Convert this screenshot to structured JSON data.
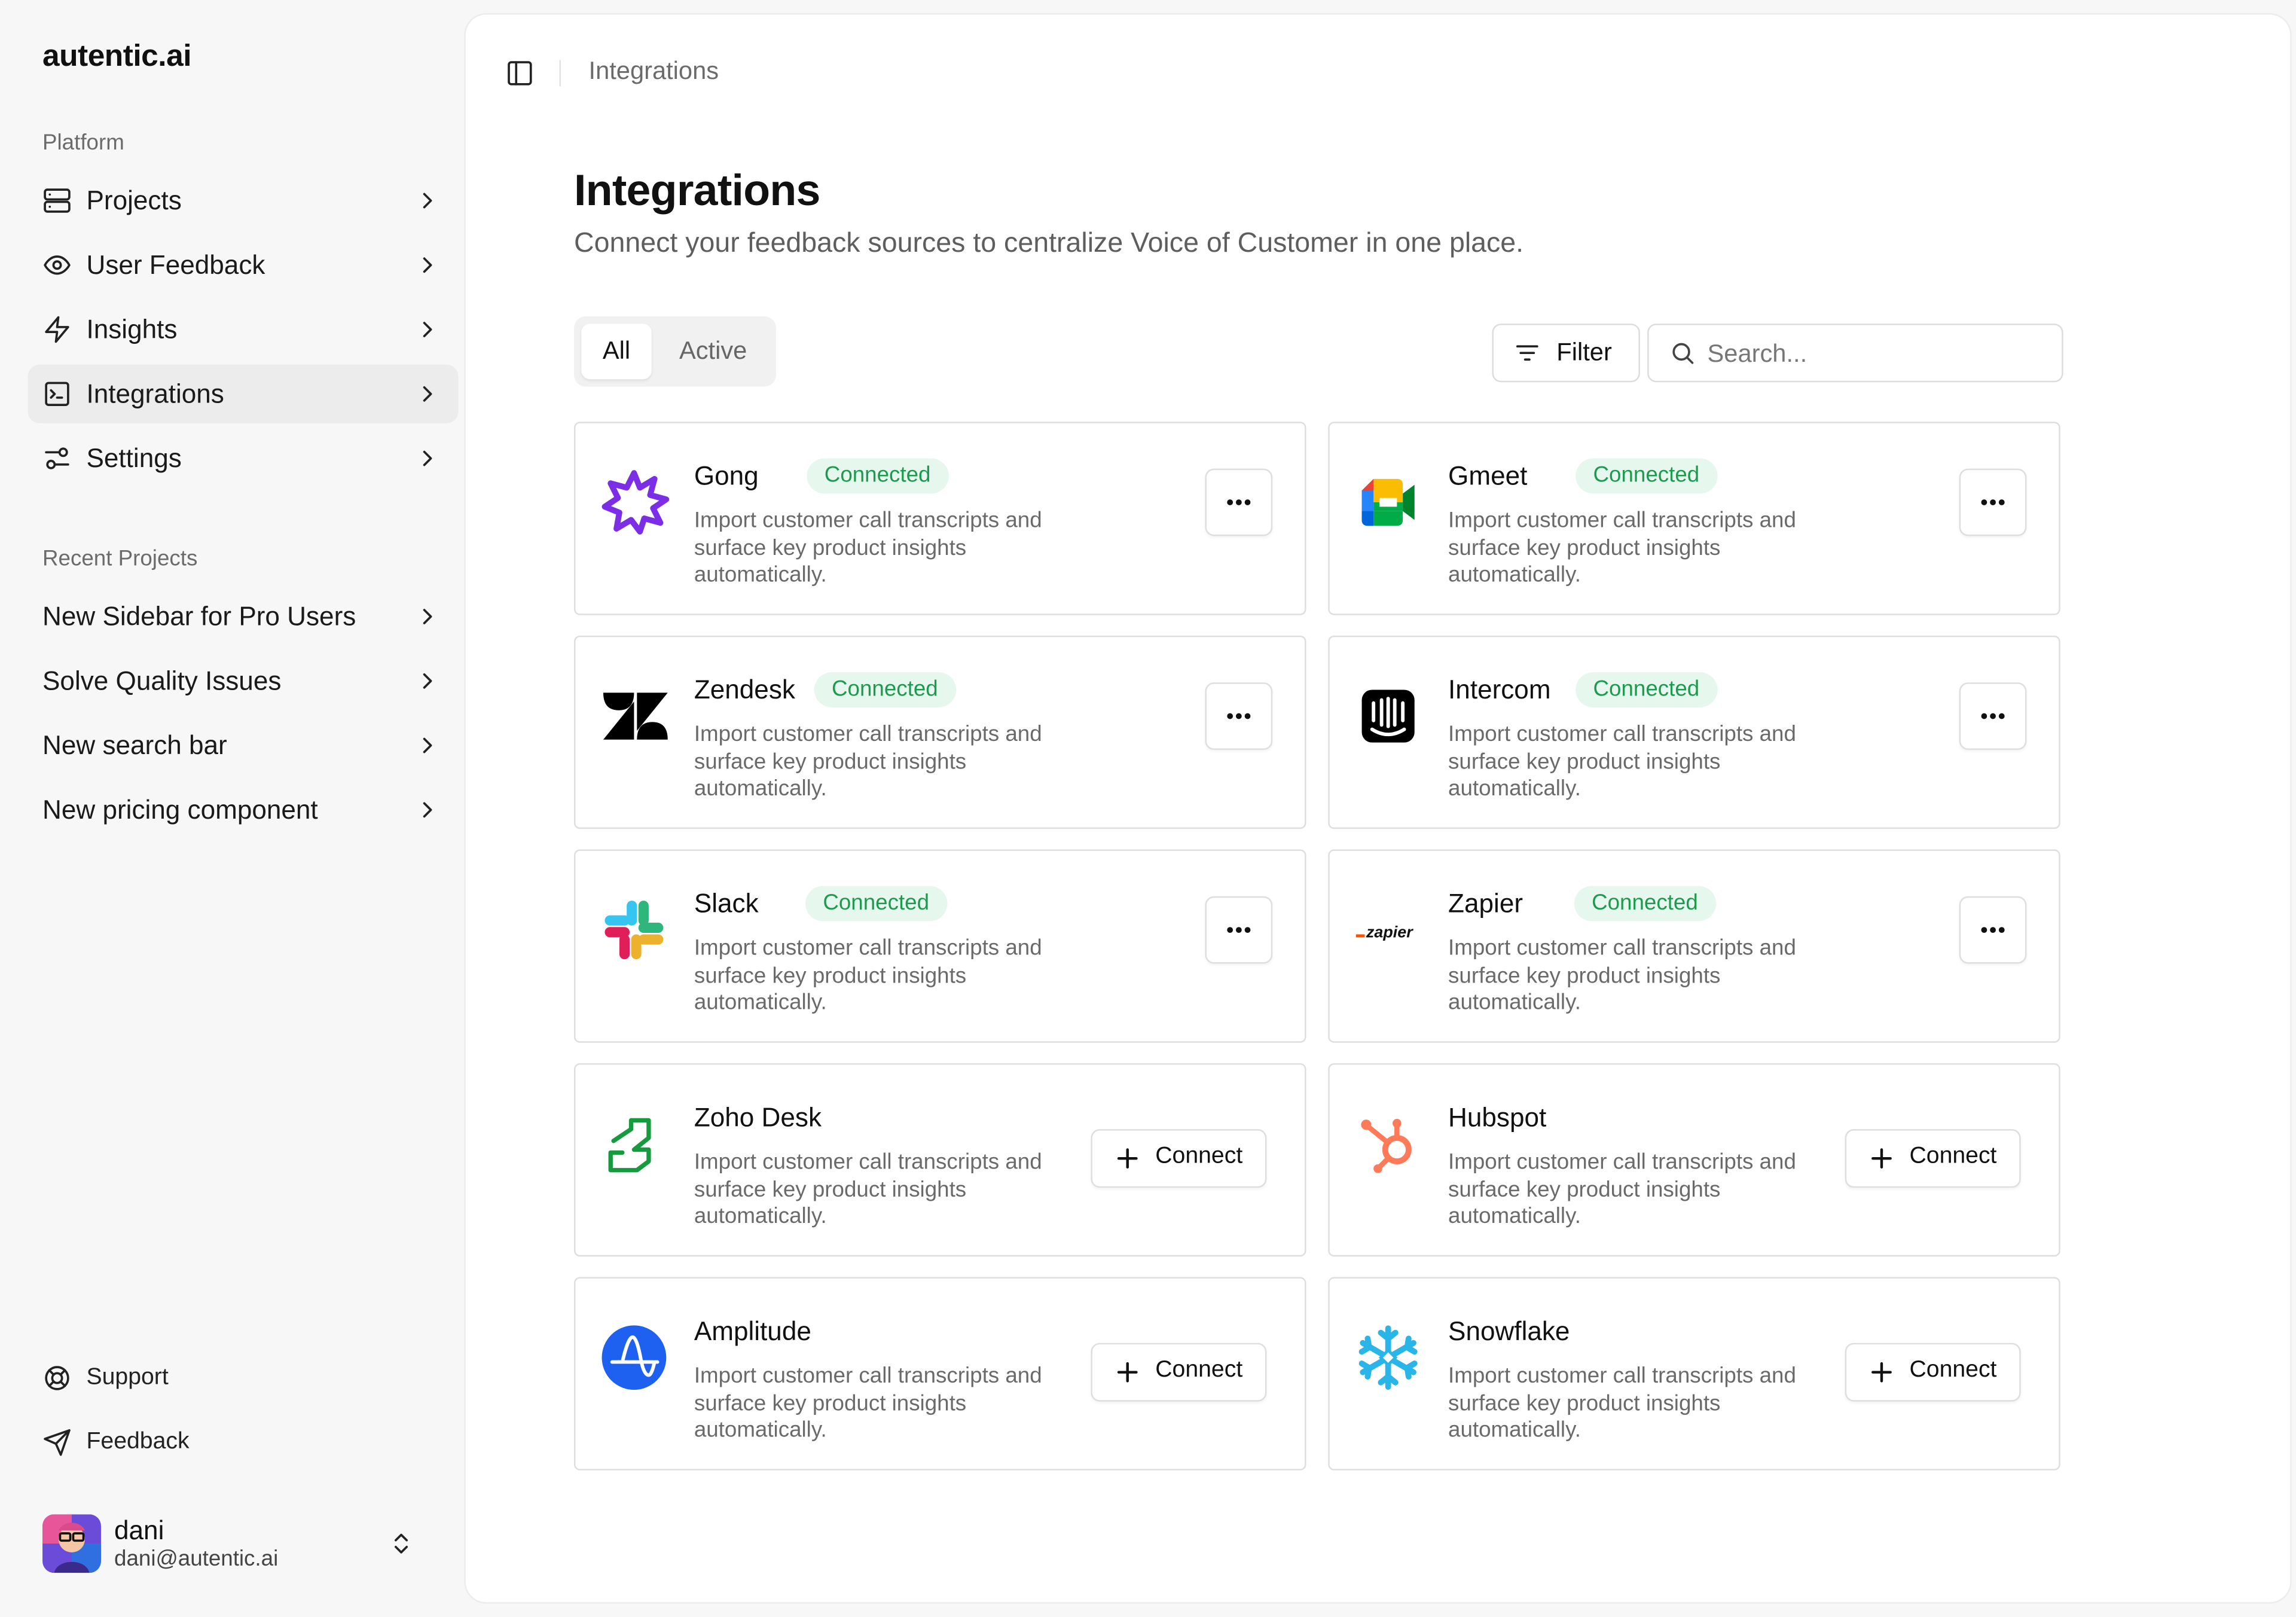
{
  "brand": "autentic.ai",
  "sidebar": {
    "platform_label": "Platform",
    "nav": [
      {
        "label": "Projects",
        "icon": "server-icon"
      },
      {
        "label": "User Feedback",
        "icon": "eye-icon"
      },
      {
        "label": "Insights",
        "icon": "zap-icon"
      },
      {
        "label": "Integrations",
        "icon": "terminal-square-icon",
        "active": true
      },
      {
        "label": "Settings",
        "icon": "sliders-icon"
      }
    ],
    "recent_label": "Recent Projects",
    "recent": [
      {
        "label": "New Sidebar for Pro Users"
      },
      {
        "label": "Solve Quality Issues"
      },
      {
        "label": "New search bar"
      },
      {
        "label": "New pricing component"
      }
    ],
    "footer": [
      {
        "label": "Support",
        "icon": "life-buoy-icon"
      },
      {
        "label": "Feedback",
        "icon": "send-icon"
      }
    ],
    "user": {
      "name": "dani",
      "email": "dani@autentic.ai"
    }
  },
  "header": {
    "breadcrumb": "Integrations"
  },
  "page": {
    "title": "Integrations",
    "subtitle": "Connect your feedback sources to centralize Voice of Customer in one place."
  },
  "tabs": [
    {
      "label": "All",
      "selected": true
    },
    {
      "label": "Active",
      "selected": false
    }
  ],
  "toolbar": {
    "filter_label": "Filter",
    "search_placeholder": "Search..."
  },
  "integrations": [
    {
      "name": "Gong",
      "status": "Connected",
      "desc": "Import customer call transcripts and surface key product insights automatically.",
      "icon": "gong-logo"
    },
    {
      "name": "Gmeet",
      "status": "Connected",
      "desc": "Import customer call transcripts and surface key product insights automatically.",
      "icon": "google-meet-logo"
    },
    {
      "name": "Zendesk",
      "status": "Connected",
      "desc": "Import customer call transcripts and surface key product insights automatically.",
      "icon": "zendesk-logo"
    },
    {
      "name": "Intercom",
      "status": "Connected",
      "desc": "Import customer call transcripts and surface key product insights automatically.",
      "icon": "intercom-logo"
    },
    {
      "name": "Slack",
      "status": "Connected",
      "desc": "Import customer call transcripts and surface key product insights automatically.",
      "icon": "slack-logo"
    },
    {
      "name": "Zapier",
      "status": "Connected",
      "desc": "Import customer call transcripts and surface key product insights automatically.",
      "icon": "zapier-logo"
    },
    {
      "name": "Zoho Desk",
      "action": "Connect",
      "desc": "Import customer call transcripts and surface key product insights automatically.",
      "icon": "zoho-desk-logo"
    },
    {
      "name": "Hubspot",
      "action": "Connect",
      "desc": "Import customer call transcripts and surface key product insights automatically.",
      "icon": "hubspot-logo"
    },
    {
      "name": "Amplitude",
      "action": "Connect",
      "desc": "Import customer call transcripts and surface key product insights automatically.",
      "icon": "amplitude-logo"
    },
    {
      "name": "Snowflake",
      "action": "Connect",
      "desc": "Import customer call transcripts and surface key product insights automatically.",
      "icon": "snowflake-logo"
    }
  ],
  "colors": {
    "connected_bg": "#e6f8ed",
    "connected_text": "#1e9a4f",
    "active_nav_bg": "#ececec",
    "page_bg": "#f7f7f7"
  }
}
